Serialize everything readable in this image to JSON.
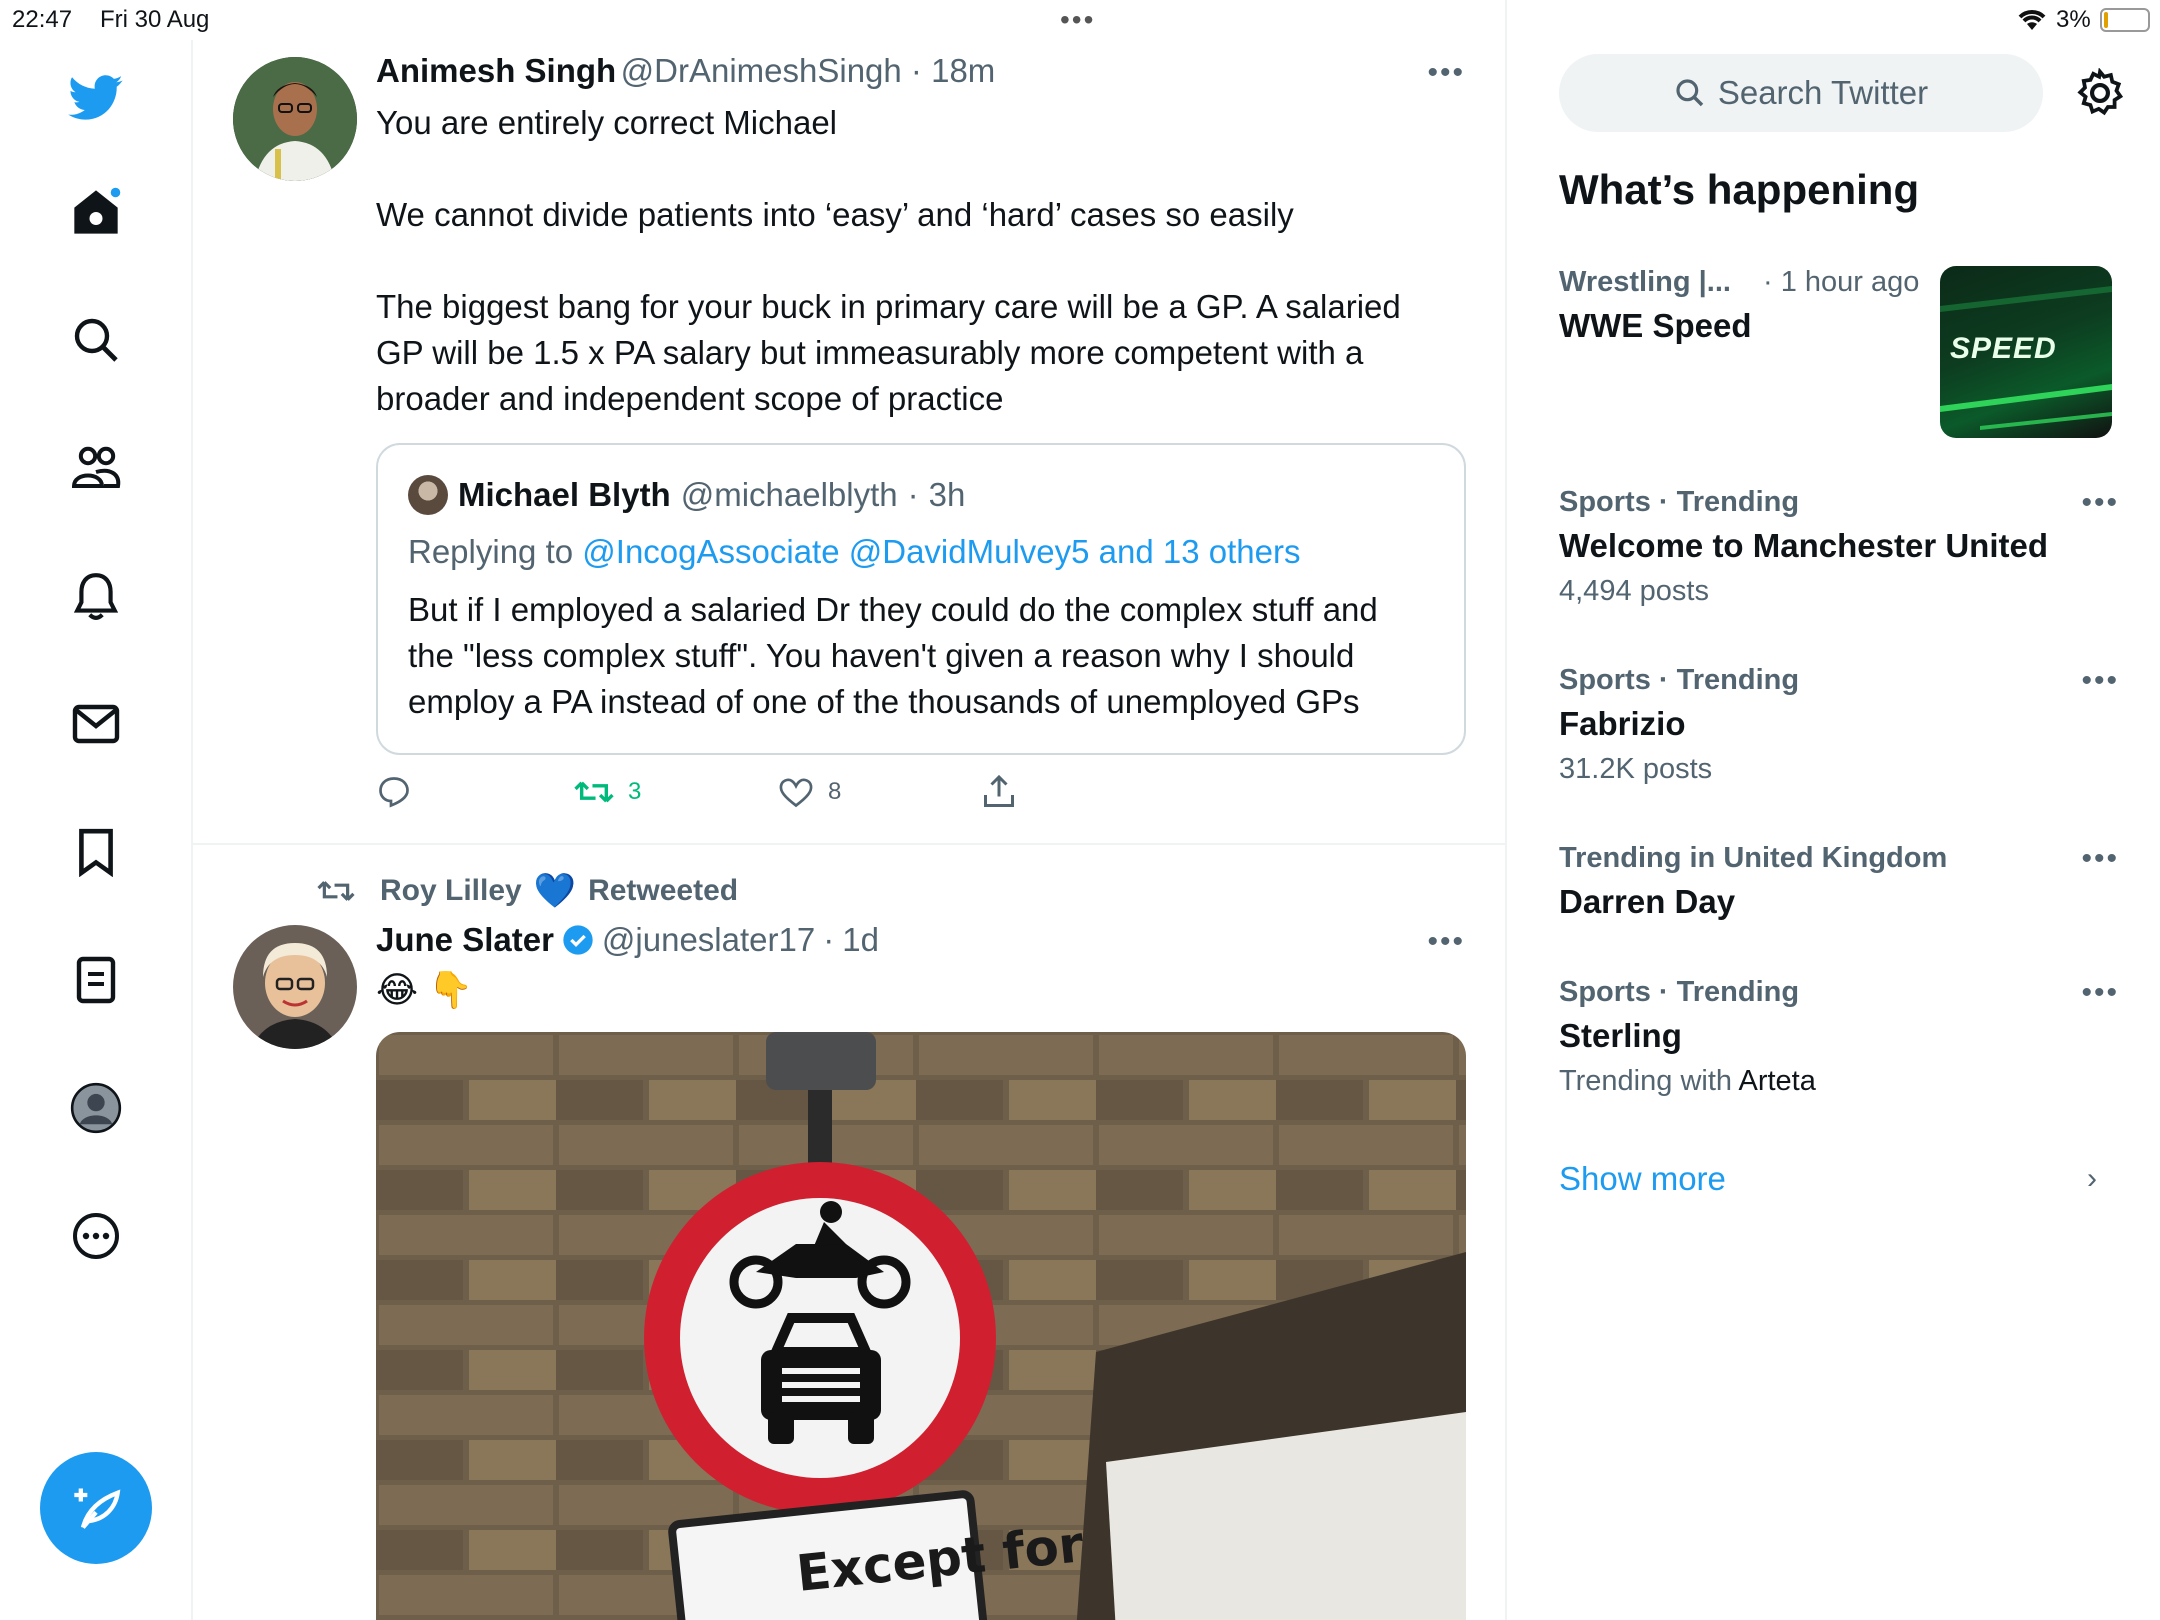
{
  "status_bar": {
    "time": "22:47",
    "date": "Fri 30 Aug",
    "battery": "3%"
  },
  "tweets": [
    {
      "name": "Animesh Singh",
      "handle": "@DrAnimeshSingh",
      "time": "18m",
      "lines": [
        "You are entirely correct Michael",
        "We cannot divide patients into ‘easy’ and ‘hard’ cases so easily",
        "The biggest bang for your buck in primary care will be a GP. A salaried",
        "GP will be 1.5 x PA salary but immeasurably more competent with a",
        "broader and independent scope of practice"
      ],
      "quote": {
        "name": "Michael Blyth",
        "handle": "@michaelblyth",
        "time": "3h",
        "replying_label": "Replying to",
        "replying_targets": "@IncogAssociate @DavidMulvey5 and 13 others",
        "lines": [
          "But if I employed a salaried Dr they could do the complex stuff and",
          "the \"less complex stuff\". You haven't given a reason why I should",
          "employ a PA instead of one of the thousands of unemployed GPs"
        ]
      },
      "retweets": "3",
      "likes": "8"
    },
    {
      "retweeted_by": "Roy Lilley",
      "retweeted_label": "Retweeted",
      "name": "June Slater",
      "handle": "@juneslater17",
      "time": "1d",
      "emoji": "😂 👇",
      "image_sign_text": "Except for"
    }
  ],
  "right": {
    "search_placeholder": "Search Twitter",
    "heading": "What’s happening",
    "trends": [
      {
        "context": "Wrestling |...",
        "age": "· 1 hour ago",
        "title": "WWE Speed",
        "thumb_text": "SPEED"
      },
      {
        "context": "Sports · Trending",
        "title": "Welcome to Manchester United",
        "meta": "4,494 posts"
      },
      {
        "context": "Sports · Trending",
        "title": "Fabrizio",
        "meta": "31.2K posts"
      },
      {
        "context": "Trending in United Kingdom",
        "title": "Darren Day"
      },
      {
        "context": "Sports · Trending",
        "title": "Sterling",
        "meta_prefix": "Trending with",
        "meta_name": "Arteta"
      }
    ],
    "show_more": "Show more"
  },
  "colors": {
    "accent": "#1d9bf0",
    "retweet_green": "#00ba7c",
    "secondary_text": "#536471"
  }
}
